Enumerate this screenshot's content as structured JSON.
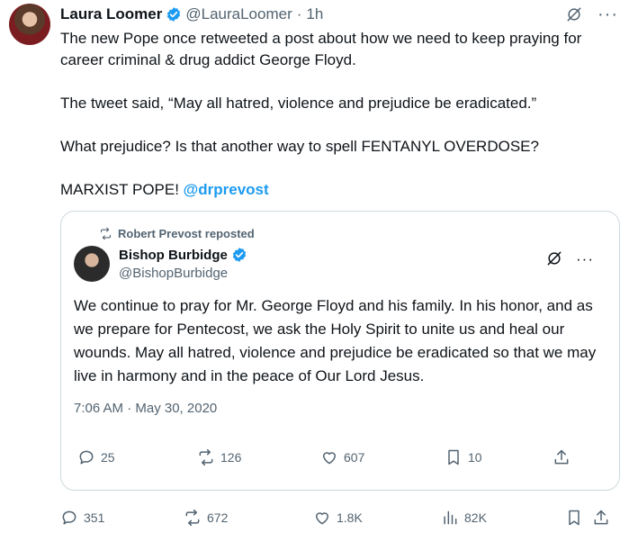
{
  "tweet": {
    "author_name": "Laura Loomer",
    "handle": "@LauraLoomer",
    "separator": "·",
    "time": "1h",
    "lines": [
      "The new Pope once retweeted a post about how we need to keep praying for career criminal & drug addict George Floyd.",
      "The tweet said, “May all hatred, violence and prejudice be eradicated.”",
      "What prejudice? Is that another way to spell FENTANYL OVERDOSE?"
    ],
    "last_line_prefix": "MARXIST POPE! ",
    "mention": "@drprevost"
  },
  "quoted": {
    "repost_label": "Robert Prevost reposted",
    "author_name": "Bishop Burbidge",
    "handle": "@BishopBurbidge",
    "text": "We continue to pray for Mr. George Floyd and his family. In his honor, and as we prepare for Pentecost, we ask the Holy Spirit to unite us and heal our wounds. May all hatred, violence and prejudice be eradicated so that we may live in harmony and in the peace of Our Lord Jesus.",
    "timestamp": "7:06 AM · May 30, 2020",
    "replies": "25",
    "reposts": "126",
    "likes": "607",
    "bookmarks": "10"
  },
  "actions": {
    "replies": "351",
    "reposts": "672",
    "likes": "1.8K",
    "views": "82K"
  },
  "colors": {
    "accent": "#1d9bf0",
    "muted": "#536471",
    "border": "#cfd9de"
  }
}
